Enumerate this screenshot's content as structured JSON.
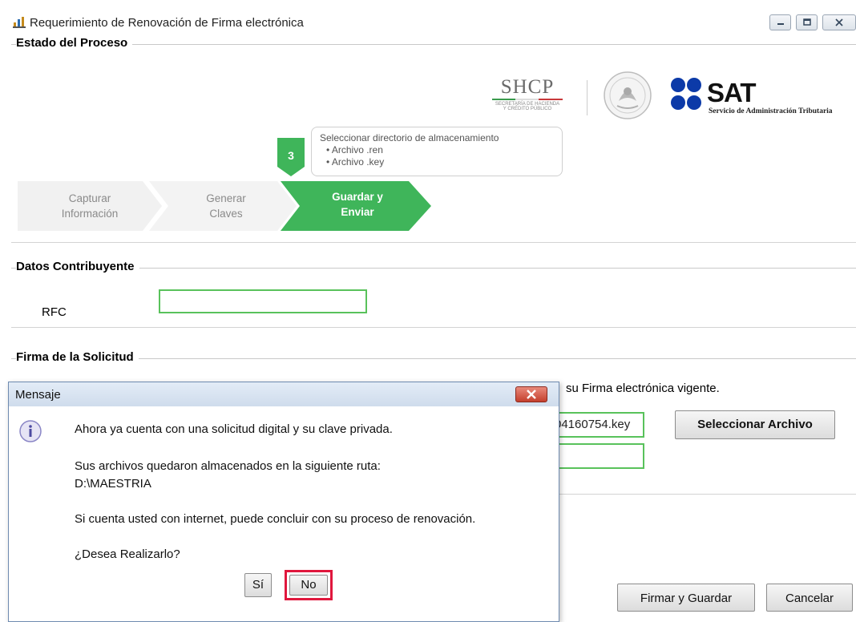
{
  "window": {
    "title": "Requerimiento de Renovación de Firma electrónica",
    "controls": [
      "minimize-icon",
      "maximize-icon",
      "close-icon"
    ]
  },
  "estado": {
    "label": "Estado del Proceso",
    "shcp": {
      "name": "SHCP",
      "line1": "SECRETARÍA DE HACIENDA",
      "line2": "Y CRÉDITO PÚBLICO"
    },
    "sat": {
      "name": "SAT",
      "subtitle": "Servicio de Administración Tributaria"
    },
    "tooltip": {
      "title": "Seleccionar directorio de almacenamiento",
      "items": [
        "Archivo .ren",
        "Archivo .key"
      ]
    },
    "step_badge": "3",
    "steps": [
      {
        "line1": "Capturar",
        "line2": "Información",
        "state": "done"
      },
      {
        "line1": "Generar",
        "line2": "Claves",
        "state": "done"
      },
      {
        "line1": "Guardar y",
        "line2": "Enviar",
        "state": "active"
      }
    ],
    "colors": {
      "active_step": "#3fb55a",
      "inactive_step": "#f1f1f1",
      "field_border": "#59c25b"
    }
  },
  "contribuyente": {
    "label": "Datos Contribuyente",
    "rfc_label": "RFC",
    "rfc_value": ""
  },
  "firma": {
    "label": "Firma de la Solicitud",
    "instruction_partial": "su Firma electrónica vigente.",
    "key_file_partial": "04160754.key",
    "password_value": "",
    "select_button": "Seleccionar Archivo"
  },
  "footer": {
    "sign_button": "Firmar y Guardar",
    "cancel_button": "Cancelar"
  },
  "dialog": {
    "title": "Mensaje",
    "line1": "Ahora ya cuenta con una solicitud digital y su clave privada.",
    "line2": "Sus archivos quedaron almacenados en la siguiente ruta:",
    "path": "D:\\MAESTRIA",
    "line3": "Si cuenta usted con internet, puede concluir con su proceso de renovación.",
    "question": "¿Desea Realizarlo?",
    "yes_button": "Sí",
    "no_button": "No",
    "highlight_color": "#e0173d"
  }
}
